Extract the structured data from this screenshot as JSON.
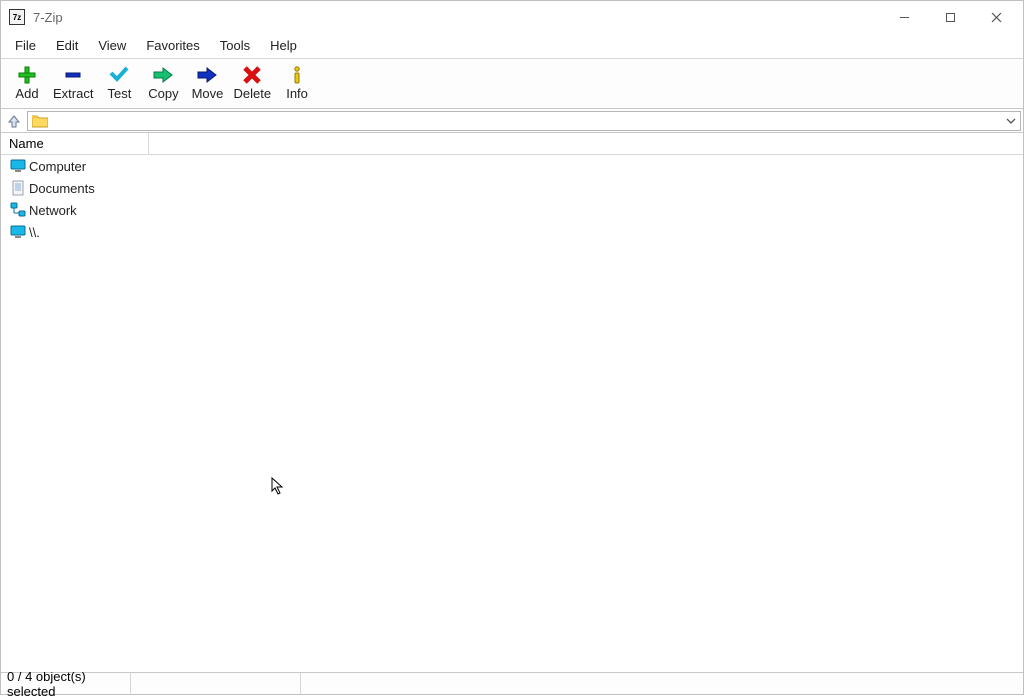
{
  "window": {
    "title": "7-Zip",
    "icon_text": "7z"
  },
  "menu": {
    "items": [
      "File",
      "Edit",
      "View",
      "Favorites",
      "Tools",
      "Help"
    ]
  },
  "toolbar": {
    "add": "Add",
    "extract": "Extract",
    "test": "Test",
    "copy": "Copy",
    "move": "Move",
    "delete": "Delete",
    "info": "Info"
  },
  "address": {
    "path": ""
  },
  "columns": {
    "name": "Name"
  },
  "rows": [
    {
      "icon": "computer",
      "label": "Computer"
    },
    {
      "icon": "document",
      "label": "Documents"
    },
    {
      "icon": "network",
      "label": "Network"
    },
    {
      "icon": "computer",
      "label": "\\\\."
    }
  ],
  "status": {
    "selection": "0 / 4 object(s) selected"
  }
}
